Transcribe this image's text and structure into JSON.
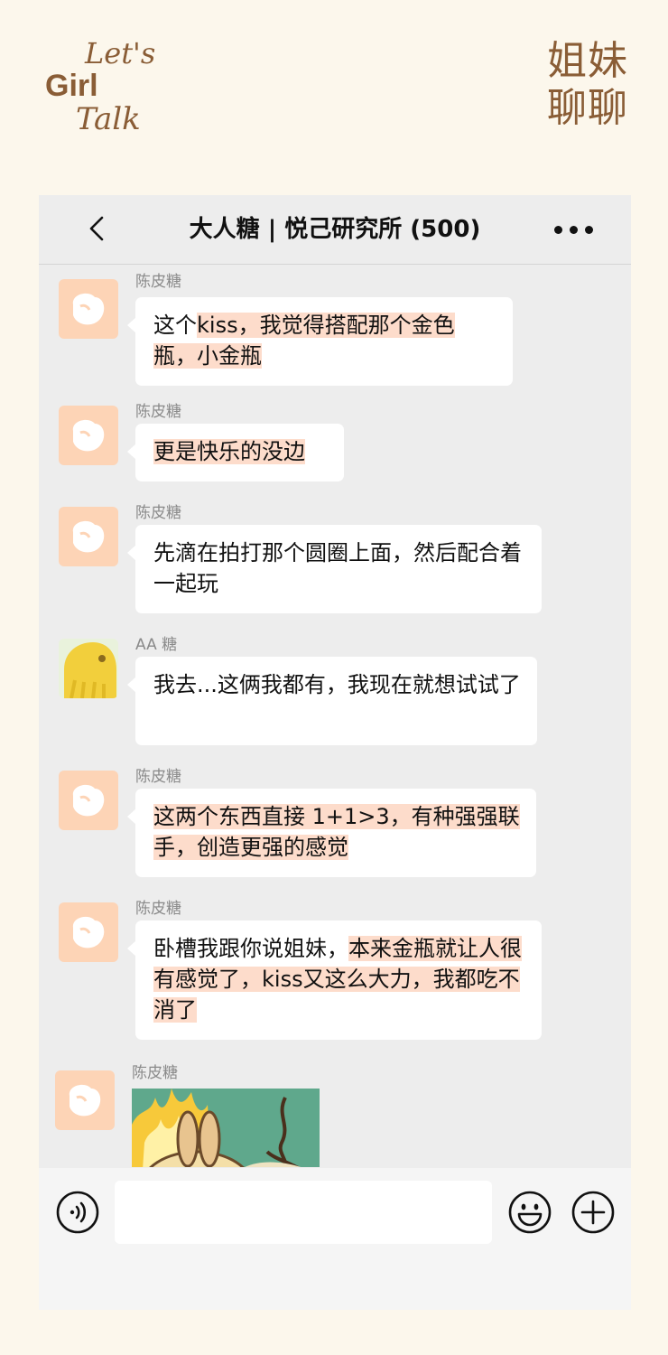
{
  "brand": {
    "logo_line1": "Let's",
    "logo_line2": "Girl",
    "logo_line3": "Talk",
    "cn_line1": "姐妹",
    "cn_line2": "聊聊",
    "color": "#8a5d36"
  },
  "header": {
    "title": "大人糖 | 悦己研究所 (500)",
    "back_icon": "chevron-left-icon",
    "more_icon": "more-dots-icon"
  },
  "messages": [
    {
      "sender": "陈皮糖",
      "parts": [
        {
          "t": "这个",
          "hl": false
        },
        {
          "t": "kiss，我觉得搭配那个金色瓶，小金瓶",
          "hl": true
        }
      ]
    },
    {
      "sender": "陈皮糖",
      "parts": [
        {
          "t": "更是快乐的没边",
          "hl": true
        }
      ]
    },
    {
      "sender": "陈皮糖",
      "parts": [
        {
          "t": "先滴在拍打那个圆圈上面，然后配合着一起玩",
          "hl": false
        }
      ]
    },
    {
      "sender": "AA 糖",
      "parts": [
        {
          "t": "我去...这俩我都有，我现在就想试试了",
          "hl": false
        }
      ]
    },
    {
      "sender": "陈皮糖",
      "parts": [
        {
          "t": "这两个东西直接 1+1>3，有种强强联手，创造更强的感觉",
          "hl": true
        }
      ]
    },
    {
      "sender": "陈皮糖",
      "parts": [
        {
          "t": "卧槽我跟你说姐妹，",
          "hl": false
        },
        {
          "t": "本来金瓶就让人很有感觉了，kiss又这么大力，我都吃不消了",
          "hl": true
        }
      ]
    },
    {
      "sender": "陈皮糖",
      "sticker": true
    }
  ],
  "input_bar": {
    "voice_icon": "voice-icon",
    "emoji_icon": "emoji-icon",
    "plus_icon": "plus-icon",
    "text_value": ""
  },
  "colors": {
    "highlight": "#fddccb",
    "chat_bg": "#ededed",
    "page_bg": "#fcf7ec"
  }
}
